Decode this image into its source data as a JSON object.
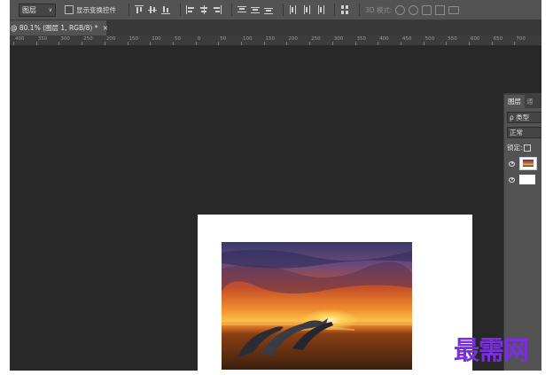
{
  "options_bar": {
    "layer_select": "图层",
    "show_transform_controls": "显示变换控件",
    "mode_3d_label": "3D 模式:"
  },
  "document_tab": {
    "title": "@ 80.1% (图层 1, RGB/8) *",
    "close": "×"
  },
  "ruler": {
    "labels": [
      "400",
      "350",
      "300",
      "250",
      "200",
      "150",
      "100",
      "50",
      "0",
      "50",
      "100",
      "150",
      "200",
      "250",
      "300",
      "350",
      "400",
      "450",
      "500",
      "550",
      "600",
      "650",
      "700"
    ]
  },
  "layers_panel": {
    "tab_layers": "图层",
    "tab_channels": "通",
    "filter_label": "ρ 类型",
    "blend_mode": "正常",
    "lock_label": "锁定:"
  },
  "watermark": "最需网",
  "colors": {
    "app_bg": "#282828",
    "panel_bg": "#535353",
    "watermark": "#7b2ee0"
  }
}
